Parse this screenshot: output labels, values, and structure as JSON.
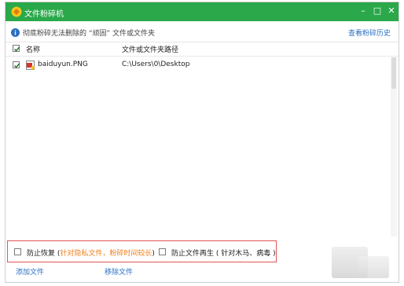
{
  "window": {
    "title": "文件粉碎机",
    "minimize_glyph": "–",
    "maximize_glyph": "□",
    "close_glyph": "✕"
  },
  "infobar": {
    "text": "彻底粉碎无法删除的 “顽固” 文件或文件夹",
    "history_link": "查看粉碎历史"
  },
  "table": {
    "columns": [
      "名称",
      "文件或文件夹路径"
    ],
    "header_checked": true,
    "rows": [
      {
        "checked": true,
        "name": "baiduyun.PNG",
        "path": "C:\\Users\\0\\Desktop",
        "icon": "image-file-icon"
      }
    ]
  },
  "options": {
    "prevent_recovery_label": "防止恢复 (",
    "prevent_recovery_hint": "针对隐私文件，粉碎时间较长",
    "prevent_recovery_close": ")",
    "prevent_regen_label": "防止文件再生 ( 针对木马、病毒 )"
  },
  "footer": {
    "add_file": "添加文件",
    "remove_file": "移除文件"
  },
  "colors": {
    "titlebar": "#2aa84a",
    "link": "#2b6fc2",
    "hint": "#f07f1a",
    "highlight_border": "#e05555"
  }
}
